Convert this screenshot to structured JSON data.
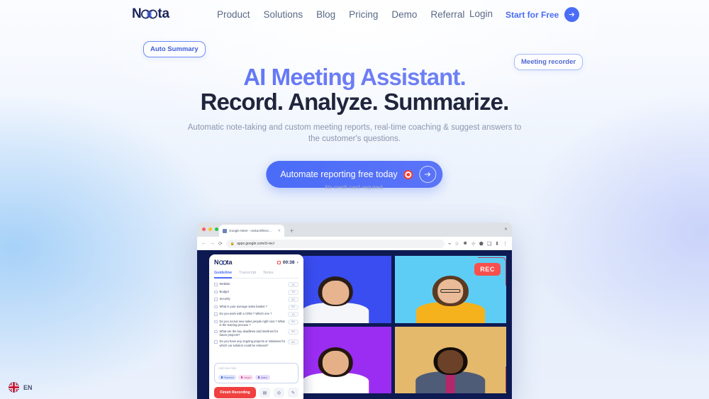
{
  "brand": {
    "name": "Noota",
    "name_prefix": "N",
    "name_suffix": "ta"
  },
  "nav": {
    "links": [
      {
        "label": "Product"
      },
      {
        "label": "Solutions"
      },
      {
        "label": "Blog"
      },
      {
        "label": "Pricing"
      },
      {
        "label": "Demo"
      },
      {
        "label": "Referral"
      }
    ],
    "login_label": "Login",
    "cta_label": "Start for Free",
    "cta_icon": "arrow-right-icon"
  },
  "badges": {
    "left": "Auto Summary",
    "right": "Meeting recorder"
  },
  "hero": {
    "title_line1": "AI Meeting Assistant.",
    "title_line2": "Record. Analyze. Summarize.",
    "subtitle": "Automatic note-taking and custom meeting reports, real-time coaching & suggest answers to the customer's questions.",
    "cta_label": "Automate reporting free today",
    "cta_record_icon": "record-icon",
    "cta_arrow_icon": "arrow-right-icon",
    "note": "No credit card required."
  },
  "mockup": {
    "browser": {
      "tab_title": "Google Meet - niokumfikrec...",
      "tab_close_icon": "close-icon",
      "new_tab_icon": "plus-icon",
      "window_close_icon": "close-icon",
      "back_icon": "arrow-left-icon",
      "forward_icon": "arrow-right-icon",
      "reload_icon": "reload-icon",
      "lock_icon": "lock-icon",
      "url": "apps.google.com/cl-rec/",
      "tools": [
        "share-icon",
        "bookmark-icon",
        "profile-icon",
        "extensions-icon",
        "app-icon",
        "window-icon",
        "download-icon",
        "menu-icon"
      ]
    },
    "panel": {
      "logo_prefix": "N",
      "logo_suffix": "ta",
      "timer": "00:38",
      "timer_stop_icon": "stop-icon",
      "timer_chevron_icon": "chevron-down-icon",
      "tabs": [
        {
          "label": "Guideline",
          "active": true
        },
        {
          "label": "Transcript",
          "active": false
        },
        {
          "label": "Notes",
          "active": false
        }
      ],
      "checklist": [
        {
          "text": "Website",
          "tag": "1/1"
        },
        {
          "text": "Budget",
          "tag": "1/1"
        },
        {
          "text": "Security",
          "tag": "0/1"
        },
        {
          "text": "What is your average sales basket ?",
          "tag": "0/1"
        },
        {
          "text": "Do you work with a CRM ? Which one ?",
          "tag": "1/1"
        },
        {
          "text": "Do you recruit new sales people right now ? What is the training process ?",
          "tag": "0/1"
        },
        {
          "text": "What are the key deadlines and timelines for future projects?",
          "tag": "0/1"
        },
        {
          "text": "Do you have any ongoing projects or initiatives for which our solution could be relevant?",
          "tag": "0/1"
        }
      ],
      "note_placeholder": "Add new note",
      "note_chips": [
        {
          "label": "Resolved",
          "icon": "check-icon"
        },
        {
          "label": "Insight",
          "icon": "star-icon"
        },
        {
          "label": "Action",
          "icon": "bolt-icon"
        }
      ],
      "finish_label": "Finish Recording",
      "actions": [
        {
          "icon": "trash-icon"
        },
        {
          "icon": "camera-icon"
        },
        {
          "icon": "edit-icon"
        }
      ]
    },
    "rec_badge": "REC",
    "video_tiles": [
      {
        "bg": "#3a4df0",
        "skin": "#e8b490",
        "hair": "#2a1d18",
        "shirt": "#f4f6f9"
      },
      {
        "bg": "#5ecdf5",
        "skin": "#e9bb98",
        "hair": "#5b3a22",
        "shirt": "#f5b21c"
      },
      {
        "bg": "#9b2df2",
        "skin": "#e5b088",
        "hair": "#241610",
        "shirt": "#ffffff"
      },
      {
        "bg": "#e4b96c",
        "skin": "#6b4228",
        "hair": "#140d09",
        "shirt": "#4f5c78"
      }
    ]
  },
  "footer": {
    "language_code": "EN",
    "flag_icon": "uk-flag-icon"
  },
  "colors": {
    "accent": "#4a6cf7",
    "dark": "#20253c",
    "record_red": "#f9504d",
    "panel_dark": "#0e1a52"
  }
}
